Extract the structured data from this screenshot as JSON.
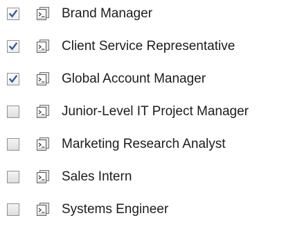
{
  "job_list": {
    "items": [
      {
        "label": "Brand Manager",
        "checked": true
      },
      {
        "label": "Client Service Representative",
        "checked": true
      },
      {
        "label": "Global Account Manager",
        "checked": true
      },
      {
        "label": "Junior-Level IT Project Manager",
        "checked": false
      },
      {
        "label": "Marketing Research Analyst",
        "checked": false
      },
      {
        "label": "Sales Intern",
        "checked": false
      },
      {
        "label": "Systems Engineer",
        "checked": false
      }
    ]
  },
  "colors": {
    "checkmark": "#3a5a98",
    "text": "#1c1c1c",
    "checkbox_border": "#8f8f8f"
  },
  "icons": {
    "item_icon": "document-icon",
    "check_icon": "checkmark-icon"
  }
}
